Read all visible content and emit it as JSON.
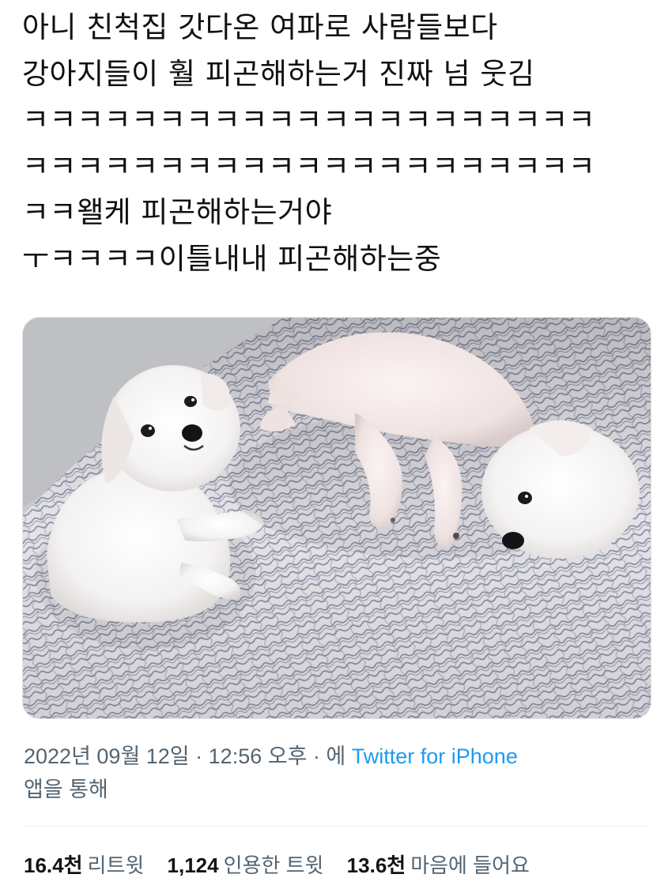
{
  "tweet": {
    "lines": [
      "아니 친척집 갓다온 여파로 사람들보다",
      "강아지들이 훨 피곤해하는거 진짜 넘 웃김",
      "ㅋㅋㅋㅋㅋㅋㅋㅋㅋㅋㅋㅋㅋㅋㅋㅋㅋㅋㅋㅋㅋ",
      "ㅋㅋㅋㅋㅋㅋㅋㅋㅋㅋㅋㅋㅋㅋㅋㅋㅋㅋㅋㅋㅋ",
      "ㅋㅋ왤케 피곤해하는거야",
      "ㅜㅋㅋㅋㅋ이틀내내 피곤해하는중"
    ]
  },
  "meta": {
    "date": "2022년 09월 12일",
    "sep1": " · ",
    "time": "12:56 오후",
    "sep2": " · ",
    "via_prefix": "에 ",
    "source": "Twitter for iPhone",
    "via_suffix": "앱을 통해"
  },
  "stats": {
    "retweets": {
      "count": "16.4천",
      "label": "리트윗"
    },
    "quotes": {
      "count": "1,124",
      "label": "인용한 트윗"
    },
    "likes": {
      "count": "13.6천",
      "label": "마음에 들어요"
    }
  },
  "colors": {
    "text": "#0f1419",
    "secondary": "#536471",
    "link": "#1d9bf0",
    "divider": "#eff3f4"
  }
}
